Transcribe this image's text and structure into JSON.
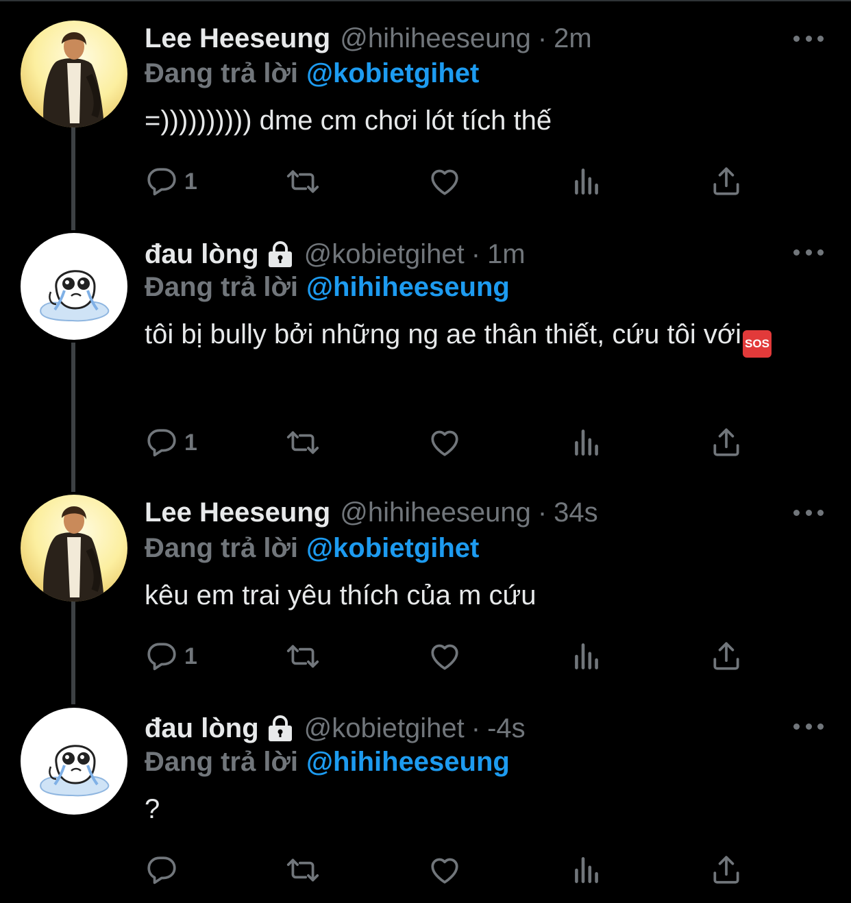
{
  "tweets": [
    {
      "name": "Lee Heeseung",
      "handle": "@hihiheeseung",
      "time": "2m",
      "reply_label": "Đang trả lời",
      "reply_to": "@kobietgihet",
      "text": "=)))))))))) dme cm chơi lót tích thế",
      "reply_count": "1",
      "avatar_icon": "portrait-photo-icon",
      "locked": false
    },
    {
      "name": "đau lòng",
      "handle": "@kobietgihet",
      "time": "1m",
      "reply_label": "Đang trả lời",
      "reply_to": "@hihiheeseung",
      "text": "tôi bị bully bởi những ng ae thân thiết, cứu tôi với",
      "emoji": "SOS",
      "reply_count": "1",
      "avatar_icon": "crying-doodle-icon",
      "locked": true
    },
    {
      "name": "Lee Heeseung",
      "handle": "@hihiheeseung",
      "time": "34s",
      "reply_label": "Đang trả lời",
      "reply_to": "@kobietgihet",
      "text": "kêu em trai yêu thích của m cứu",
      "reply_count": "1",
      "avatar_icon": "portrait-photo-icon",
      "locked": false
    },
    {
      "name": "đau lòng",
      "handle": "@kobietgihet",
      "time": "-4s",
      "reply_label": "Đang trả lời",
      "reply_to": "@hihiheeseung",
      "text": "?",
      "reply_count": "",
      "avatar_icon": "crying-doodle-icon",
      "locked": true
    }
  ],
  "icons": {
    "reply": "reply-icon",
    "retweet": "retweet-icon",
    "like": "heart-icon",
    "analytics": "analytics-icon",
    "share": "share-icon",
    "more": "more-options-icon",
    "lock": "lock-icon"
  },
  "colors": {
    "background": "#000000",
    "text": "#e7e9ea",
    "muted": "#71767b",
    "accent": "#1d9bf0",
    "thread_line": "#3d4144"
  }
}
